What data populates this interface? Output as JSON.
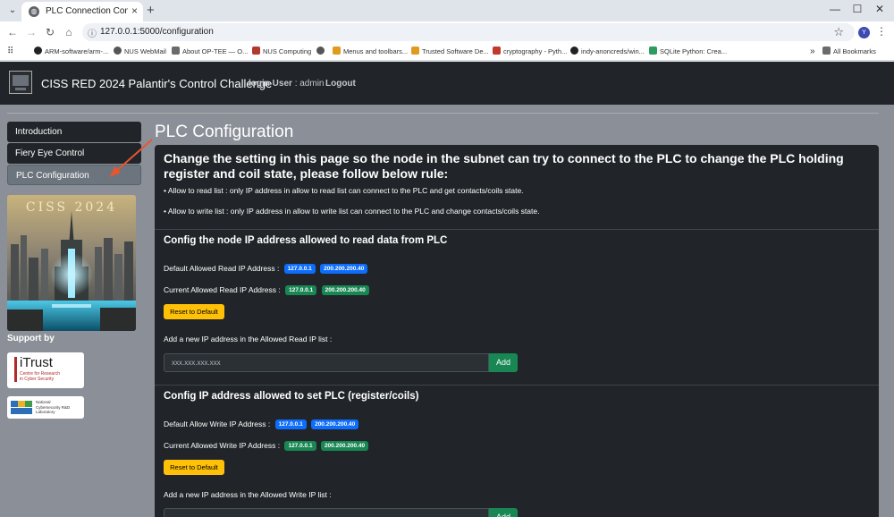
{
  "browser": {
    "tab_title": "PLC Connection Configuratio",
    "url": "127.0.0.1:5000/configuration",
    "profile_initial": "Y",
    "bookmarks": [
      "ARM-software/arm-...",
      "NUS WebMail",
      "About OP-TEE — O...",
      "NUS Computing",
      "Menus and toolbars...",
      "Trusted Software De...",
      "cryptography - Pyth...",
      "indy-anoncreds/win...",
      "SQLite Python: Crea..."
    ],
    "all_bookmarks": "All Bookmarks"
  },
  "navbar": {
    "brand": "CISS RED 2024 Palantir's Control Challenge",
    "login_label": "login User",
    "login_value": ": admin",
    "logout": "Logout"
  },
  "sidebar": {
    "items": [
      "Introduction",
      "Fiery Eye Control",
      "PLC Configuration"
    ],
    "hero_caption": "CISS 2024",
    "support_label": "Support by",
    "itrust_name": "iTrust",
    "itrust_sub1": "Centre for Research",
    "itrust_sub2": "in Cyber Security",
    "ncl_line1": "National",
    "ncl_line2": "Cybersecurity R&D",
    "ncl_line3": "Laboratory"
  },
  "page": {
    "title": "PLC Configuration",
    "intro": "Change the setting in this page so the node in the subnet can try to connect to the PLC to change the PLC holding register and coil state, please follow below rule:",
    "rule_read": "• Allow to read list : only IP address in allow to read list can connect to the PLC and get contacts/coils state.",
    "rule_write": "• Allow to write list : only IP address in allow to write list can connect to the PLC and change contacts/coils state."
  },
  "read_section": {
    "title": "Config the node IP address allowed to read data from PLC",
    "default_label": "Default Allowed Read IP Address :",
    "default_ips": [
      "127.0.0.1",
      "200.200.200.40"
    ],
    "current_label": "Current Allowed Read IP Address :",
    "current_ips": [
      "127.0.0.1",
      "200.200.200.40"
    ],
    "reset_label": "Reset to Default",
    "add_prompt": "Add a new IP address in the Allowed Read IP list :",
    "input_placeholder": "xxx.xxx.xxx.xxx",
    "add_label": "Add"
  },
  "write_section": {
    "title": "Config IP address allowed to set PLC (register/coils)",
    "default_label": "Default Allow Write IP Address :",
    "default_ips": [
      "127.0.0.1",
      "200.200.200.40"
    ],
    "current_label": "Current Allowed Write IP Address :",
    "current_ips": [
      "127.0.0.1",
      "200.200.200.40"
    ],
    "reset_label": "Reset to Default",
    "add_prompt": "Add a new IP address in the Allowed Write IP list :",
    "add_label": "Add"
  },
  "colors": {
    "badge_default": "#0d6efd",
    "badge_current": "#198754",
    "reset_button": "#ffc107",
    "add_button": "#198754",
    "annotation_arrow": "#e8552f"
  }
}
